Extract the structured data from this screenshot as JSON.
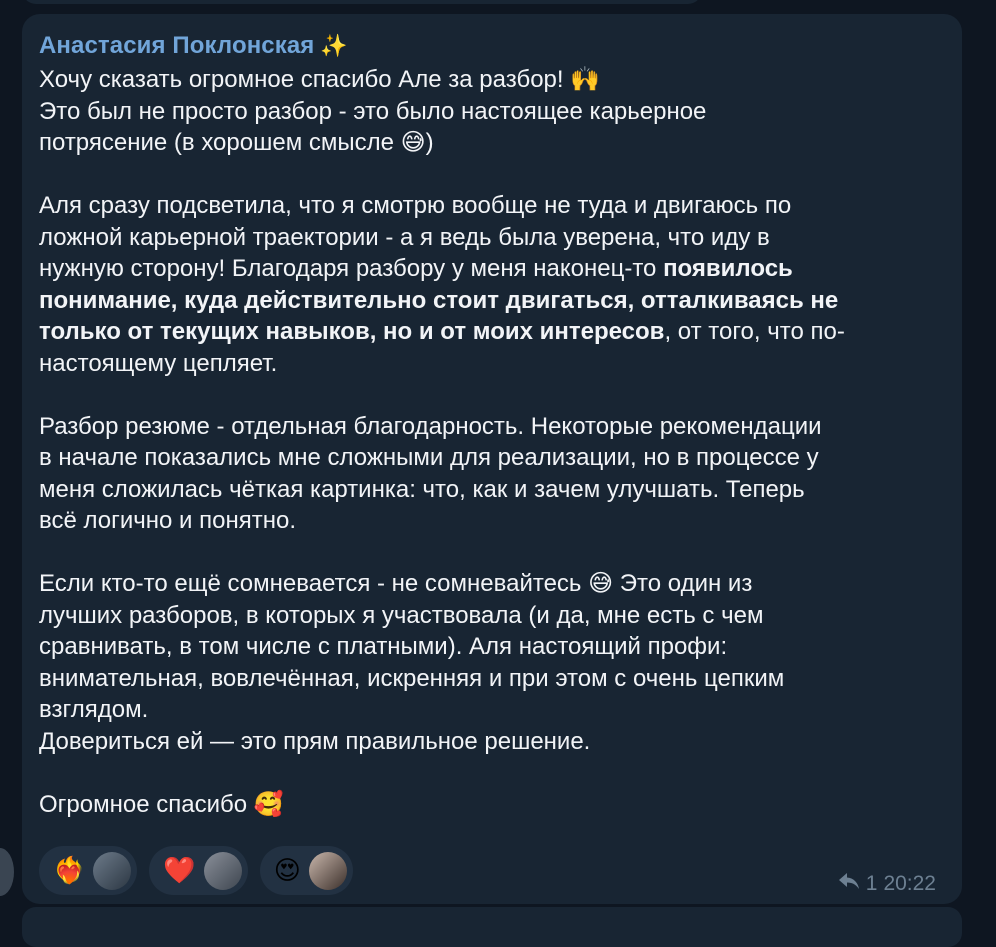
{
  "author": "Анастасия Поклонская",
  "author_badge": "✨",
  "lines": [
    "Хочу сказать огромное спасибо Але за разбор! 🙌",
    "Это был не просто разбор - это было настоящее карьерное",
    "потрясение (в хорошем смысле 😅)",
    "",
    "Аля сразу подсветила, что я смотрю вообще не туда и двигаюсь по",
    "ложной карьерной траектории - а я ведь была уверена, что иду в"
  ],
  "line7_pre": "нужную сторону! Благодаря разбору у меня наконец-то ",
  "line7_bold": "появилось",
  "line8_bold": "понимание, куда действительно стоит двигаться, отталкиваясь не",
  "line9_bold": "только от текущих навыков, но и от моих интересов",
  "line9_rest": ", от того, что по-",
  "lines_b": [
    "настоящему цепляет.",
    "",
    "Разбор резюме - отдельная благодарность. Некоторые рекомендации",
    "в начале показались мне сложными для реализации, но в процессе у",
    "меня сложилась чёткая картинка: что, как и зачем улучшать. Теперь",
    "всё логично и понятно.",
    "",
    "Если кто-то ещё сомневается - не сомневайтесь 😅 Это один из",
    "лучших разборов, в которых я участвовала (и да, мне есть с чем",
    "сравнивать, в том числе с платными). Аля настоящий профи:",
    "внимательная, вовлечённая, искренняя и при этом с очень цепким",
    "взглядом.",
    "Довериться ей — это прям правильное решение.",
    "",
    "Огромное спасибо 🥰"
  ],
  "reactions": [
    {
      "emoji": "❤️‍🔥",
      "avatar": "user-avatar"
    },
    {
      "emoji": "❤️",
      "avatar": "user-avatar"
    },
    {
      "emoji": "😍",
      "avatar": "user-avatar"
    }
  ],
  "meta": {
    "reply_icon": "reply-arrow-icon",
    "replies": "1",
    "time": "20:22"
  }
}
